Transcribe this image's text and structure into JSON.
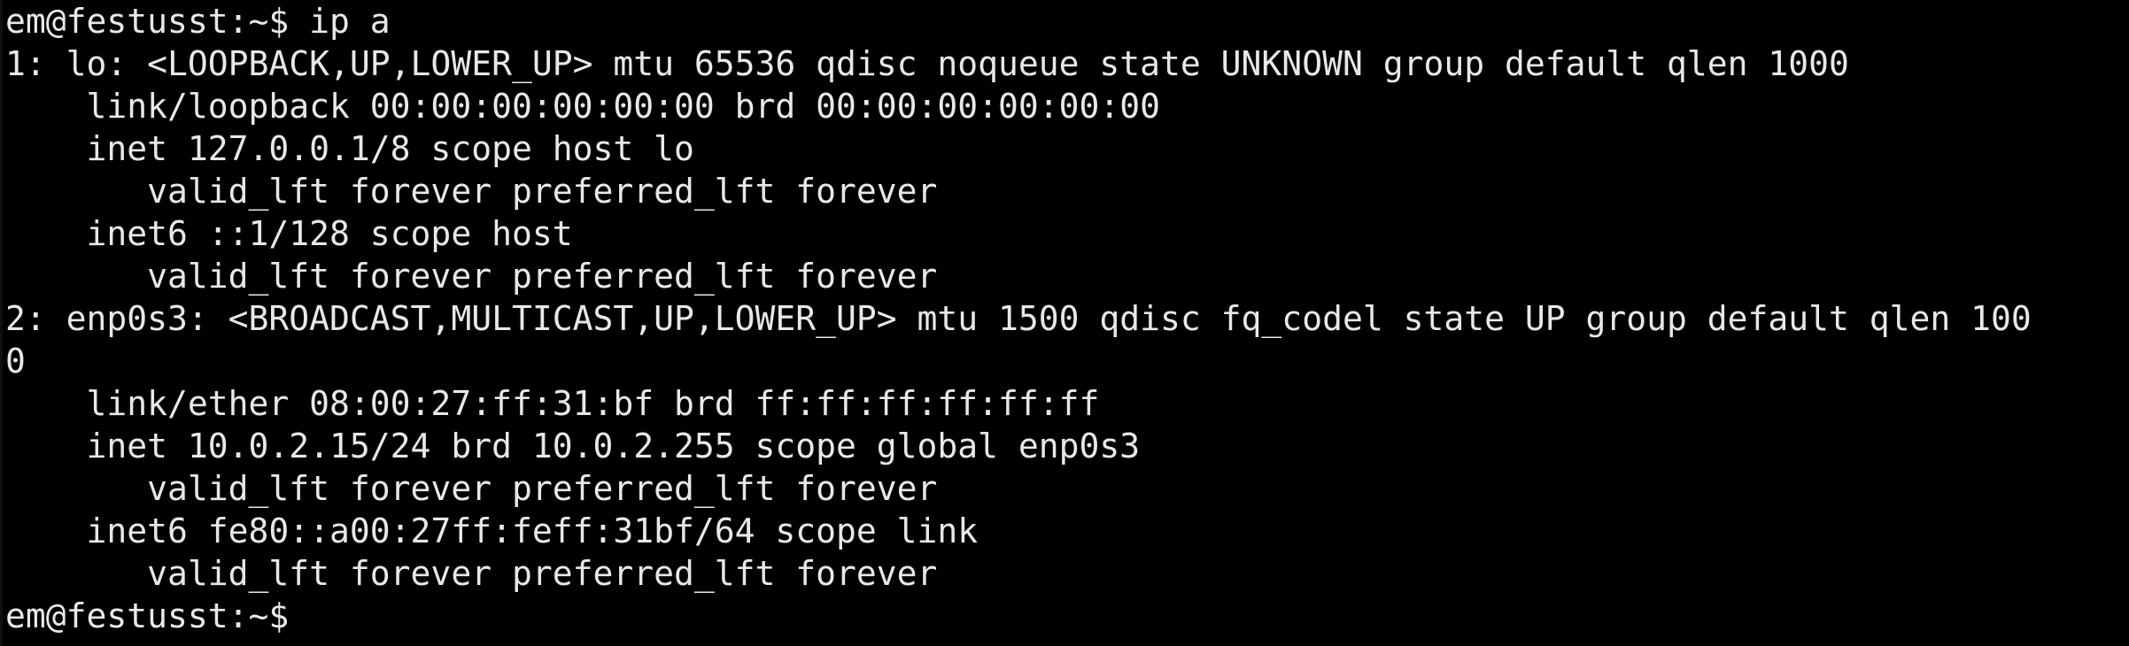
{
  "terminal": {
    "lines": [
      "em@festusst:~$ ip a",
      "1: lo: <LOOPBACK,UP,LOWER_UP> mtu 65536 qdisc noqueue state UNKNOWN group default qlen 1000",
      "    link/loopback 00:00:00:00:00:00 brd 00:00:00:00:00:00",
      "    inet 127.0.0.1/8 scope host lo",
      "       valid_lft forever preferred_lft forever",
      "    inet6 ::1/128 scope host",
      "       valid_lft forever preferred_lft forever",
      "2: enp0s3: <BROADCAST,MULTICAST,UP,LOWER_UP> mtu 1500 qdisc fq_codel state UP group default qlen 100",
      "0",
      "    link/ether 08:00:27:ff:31:bf brd ff:ff:ff:ff:ff:ff",
      "    inet 10.0.2.15/24 brd 10.0.2.255 scope global enp0s3",
      "       valid_lft forever preferred_lft forever",
      "    inet6 fe80::a00:27ff:feff:31bf/64 scope link",
      "       valid_lft forever preferred_lft forever",
      "em@festusst:~$ "
    ]
  },
  "colors": {
    "background": "#000000",
    "foreground": "#e8e8e8"
  }
}
